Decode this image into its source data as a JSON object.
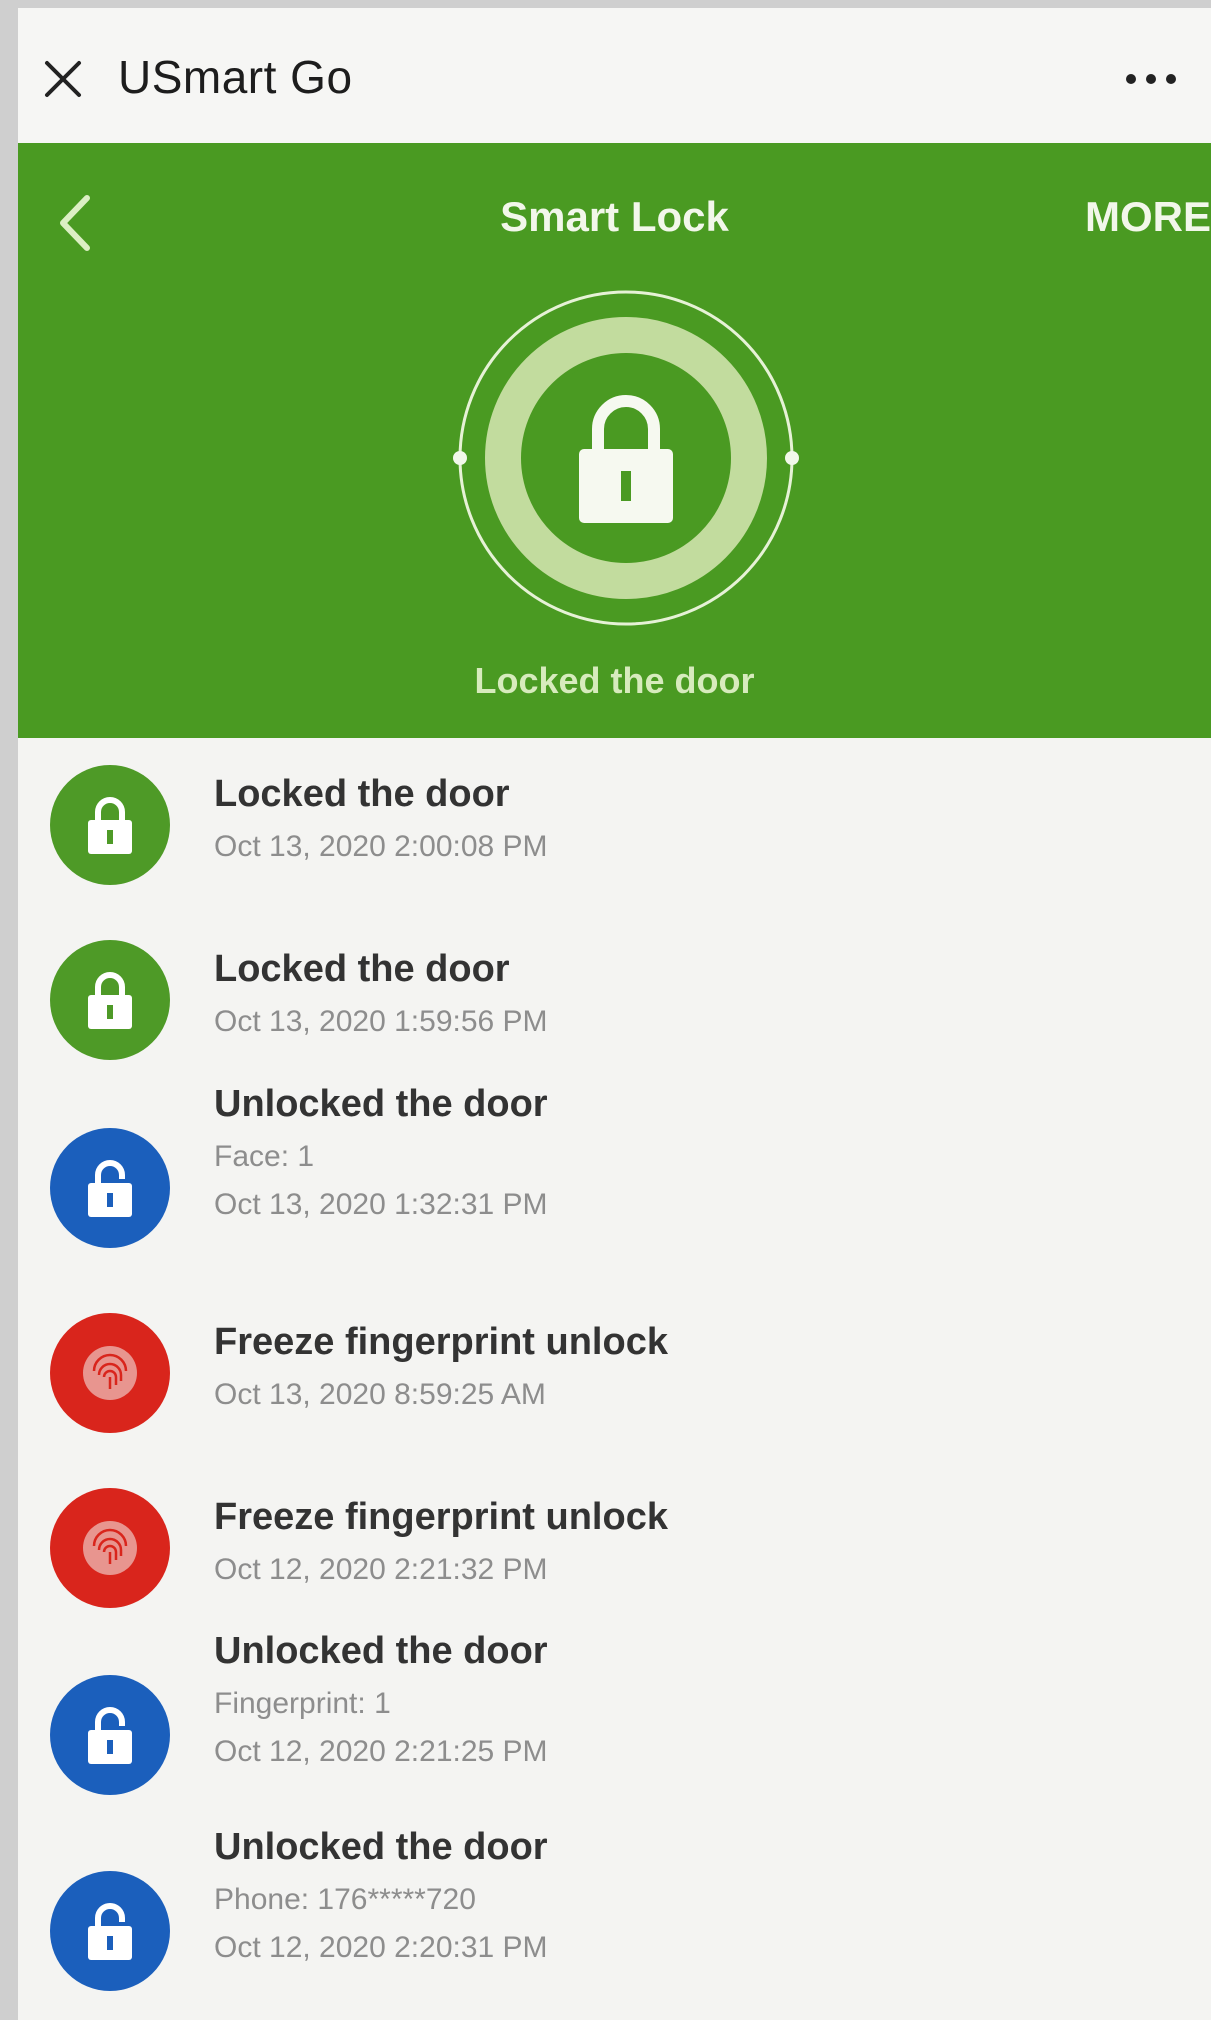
{
  "window": {
    "title": "USmart Go",
    "close_icon": "close-icon",
    "menu_icon": "more-dots-icon"
  },
  "header": {
    "title": "Smart Lock",
    "more_label": "MORE",
    "status_label": "Locked the door",
    "background_color": "#4a9a22",
    "lock_state": "locked"
  },
  "colors": {
    "locked": "#4e9a27",
    "unlocked": "#1b5fbc",
    "freeze": "#d9251c"
  },
  "log": [
    {
      "type": "locked",
      "icon": "lock-icon",
      "title": "Locked the door",
      "detail": "",
      "time": "Oct 13, 2020 2:00:08 PM"
    },
    {
      "type": "locked",
      "icon": "lock-icon",
      "title": "Locked the door",
      "detail": "",
      "time": "Oct 13, 2020 1:59:56 PM"
    },
    {
      "type": "unlocked",
      "icon": "unlock-icon",
      "title": "Unlocked the door",
      "detail": "Face: 1",
      "time": "Oct 13, 2020 1:32:31 PM"
    },
    {
      "type": "freeze",
      "icon": "fingerprint-icon",
      "title": "Freeze fingerprint unlock",
      "detail": "",
      "time": "Oct 13, 2020 8:59:25 AM"
    },
    {
      "type": "freeze",
      "icon": "fingerprint-icon",
      "title": "Freeze fingerprint unlock",
      "detail": "",
      "time": "Oct 12, 2020 2:21:32 PM"
    },
    {
      "type": "unlocked",
      "icon": "unlock-icon",
      "title": "Unlocked the door",
      "detail": "Fingerprint: 1",
      "time": "Oct 12, 2020 2:21:25 PM"
    },
    {
      "type": "unlocked",
      "icon": "unlock-icon",
      "title": "Unlocked the door",
      "detail": "Phone: 176*****720",
      "time": "Oct 12, 2020 2:20:31 PM"
    }
  ]
}
